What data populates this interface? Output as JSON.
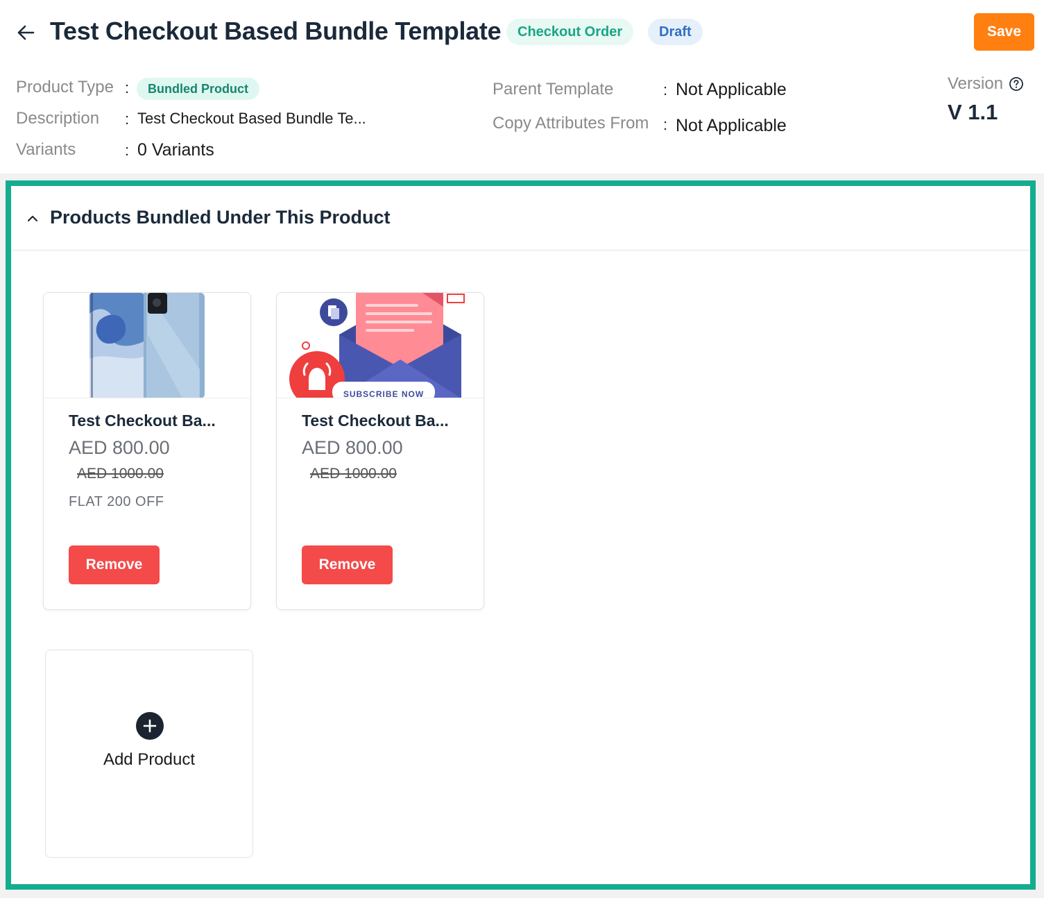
{
  "header": {
    "title": "Test Checkout Based Bundle Template",
    "badges": {
      "checkout": "Checkout Order",
      "draft": "Draft"
    },
    "save_label": "Save"
  },
  "meta": {
    "product_type_label": "Product Type",
    "product_type_value": "Bundled Product",
    "description_label": "Description",
    "description_value": "Test Checkout Based Bundle Te...",
    "variants_label": "Variants",
    "variants_value": "0 Variants",
    "parent_template_label": "Parent Template",
    "parent_template_value": "Not Applicable",
    "copy_attributes_label": "Copy Attributes From",
    "copy_attributes_value": "Not Applicable",
    "colon": ":",
    "version_label": "Version",
    "version_value": "V 1.1"
  },
  "panel": {
    "title": "Products Bundled Under This Product",
    "products": [
      {
        "name": "Test Checkout Ba...",
        "price": "AED 800.00",
        "mrp": "AED 1000.00",
        "offer": "FLAT 200 OFF",
        "remove_label": "Remove"
      },
      {
        "name": "Test Checkout Ba...",
        "price": "AED 800.00",
        "mrp": "AED 1000.00",
        "offer": "",
        "remove_label": "Remove",
        "image_text": "SUBSCRIBE NOW"
      }
    ],
    "add_product_label": "Add Product"
  },
  "colors": {
    "accent": "#15ad8f",
    "save": "#ff7f11",
    "remove": "#f44a4a",
    "title": "#1b2a3a"
  },
  "icons": [
    "back-arrow-icon",
    "help-circle-icon",
    "chevron-up-icon",
    "plus-icon"
  ]
}
